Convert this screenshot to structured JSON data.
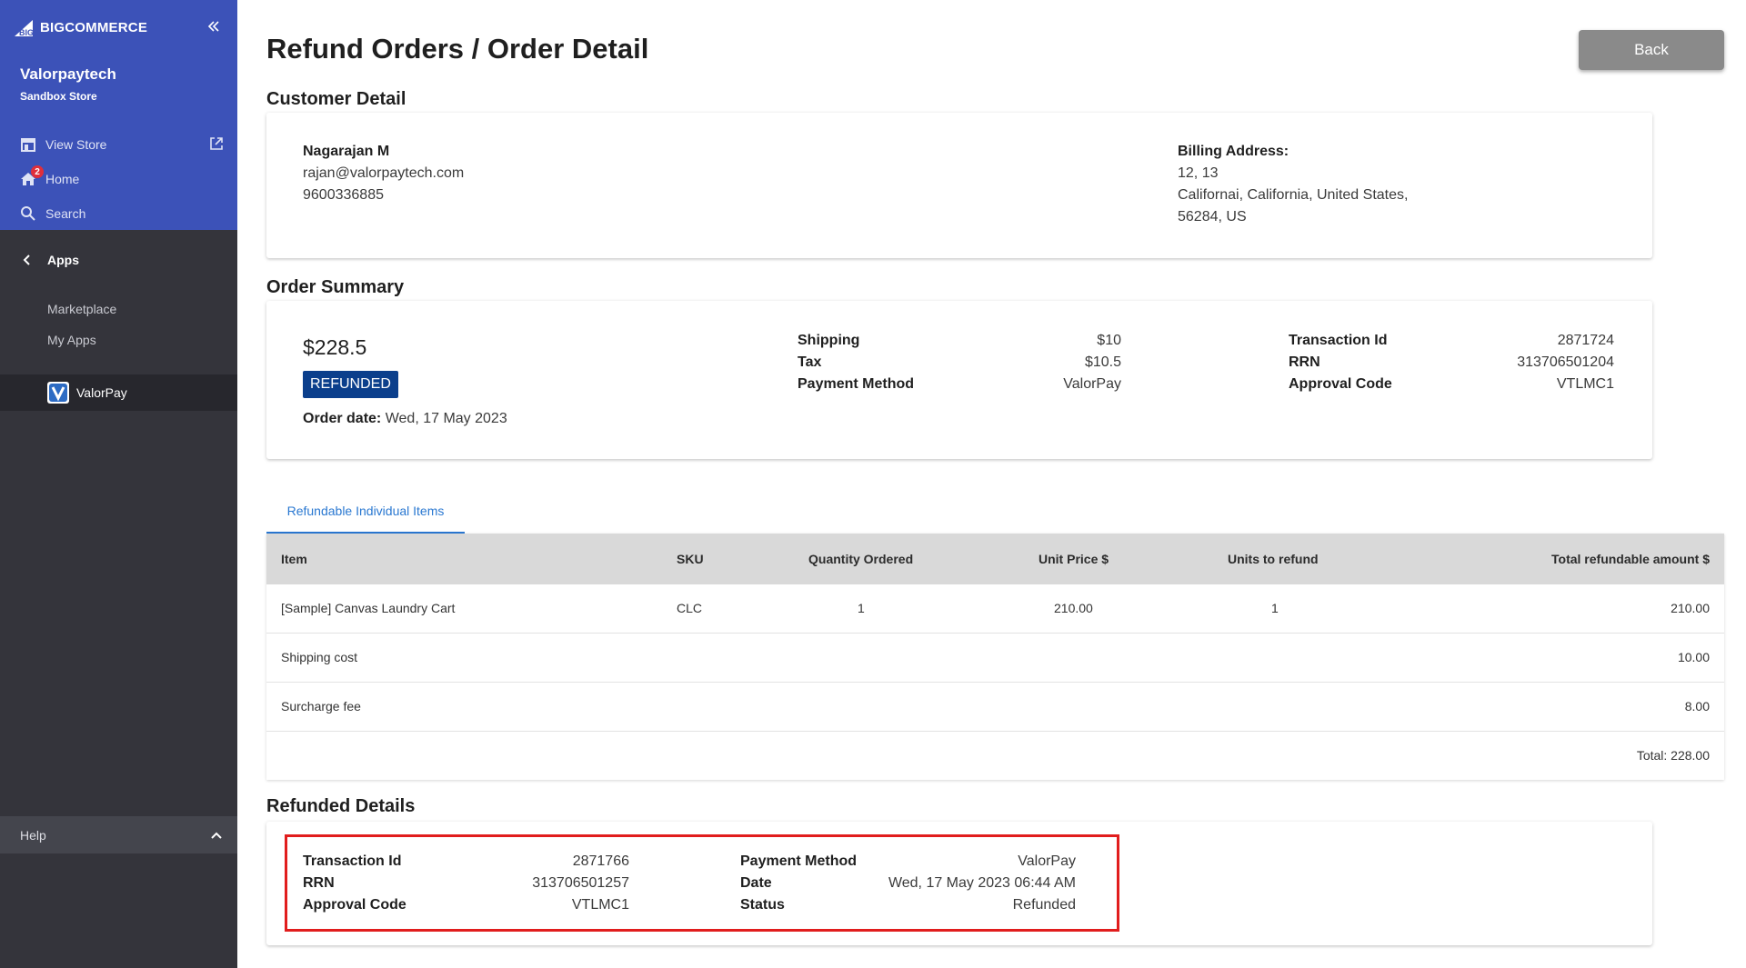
{
  "sidebar": {
    "logo_text": "BIGCOMMERCE",
    "store_name": "Valorpaytech",
    "store_subtitle": "Sandbox Store",
    "nav": [
      {
        "label": "View Store",
        "icon": "storefront-icon"
      },
      {
        "label": "Home",
        "icon": "home-icon",
        "badge": "2"
      },
      {
        "label": "Search",
        "icon": "search-icon"
      }
    ],
    "apps_label": "Apps",
    "apps_items": [
      "Marketplace",
      "My Apps"
    ],
    "active_app": "ValorPay",
    "help_label": "Help"
  },
  "page": {
    "title": "Refund Orders / Order Detail",
    "back_label": "Back"
  },
  "customer": {
    "section_title": "Customer Detail",
    "name": "Nagarajan M",
    "email": "rajan@valorpaytech.com",
    "phone": "9600336885",
    "billing_label": "Billing Address:",
    "billing_line1": "12, 13",
    "billing_line2": "Californai, California, United States,",
    "billing_line3": "56284, US"
  },
  "summary": {
    "section_title": "Order Summary",
    "amount": "$228.5",
    "status": "REFUNDED",
    "order_date_label": "Order date:",
    "order_date": "Wed, 17 May 2023",
    "shipping_label": "Shipping",
    "shipping": "$10",
    "tax_label": "Tax",
    "tax": "$10.5",
    "payment_method_label": "Payment Method",
    "payment_method": "ValorPay",
    "transaction_id_label": "Transaction Id",
    "transaction_id": "2871724",
    "rrn_label": "RRN",
    "rrn": "313706501204",
    "approval_code_label": "Approval Code",
    "approval_code": "VTLMC1"
  },
  "items": {
    "tab_label": "Refundable Individual Items",
    "headers": {
      "item": "Item",
      "sku": "SKU",
      "qty": "Quantity Ordered",
      "unit_price": "Unit Price $",
      "units_refund": "Units to refund",
      "total": "Total refundable amount $"
    },
    "rows": [
      {
        "item": "[Sample] Canvas Laundry Cart",
        "sku": "CLC",
        "qty": "1",
        "unit_price": "210.00",
        "units_refund": "1",
        "total": "210.00"
      },
      {
        "item": "Shipping cost",
        "total": "10.00"
      },
      {
        "item": "Surcharge fee",
        "total": "8.00"
      }
    ],
    "total_text": "Total: 228.00"
  },
  "refunded": {
    "section_title": "Refunded Details",
    "transaction_id_label": "Transaction Id",
    "transaction_id": "2871766",
    "rrn_label": "RRN",
    "rrn": "313706501257",
    "approval_code_label": "Approval Code",
    "approval_code": "VTLMC1",
    "payment_method_label": "Payment Method",
    "payment_method": "ValorPay",
    "date_label": "Date",
    "date": "Wed, 17 May 2023 06:44 AM",
    "status_label": "Status",
    "status": "Refunded"
  },
  "colors": {
    "sidebar_top": "#3c52b8",
    "sidebar_body": "#34343b",
    "status_badge": "#0b3f8c",
    "tab_accent": "#2a78d1",
    "highlight_border": "#e11d1d"
  }
}
